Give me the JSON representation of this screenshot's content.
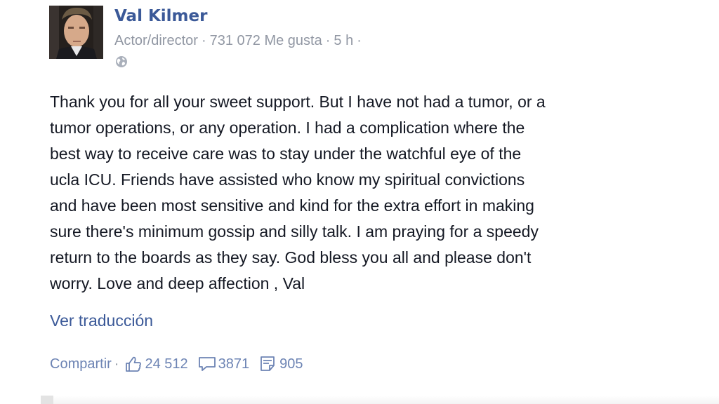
{
  "post": {
    "author": "Val Kilmer",
    "meta": {
      "category": "Actor/director",
      "likes_count": "731 072 Me gusta",
      "time": "5 h",
      "separator": "·"
    },
    "privacy_icon": "globe-icon",
    "body_lines": [
      "Thank you for all your sweet support. But I have not had a tumor, or a",
      "tumor operations, or any operation. I had a complication where the",
      "best way to receive care was to stay under the watchful eye of the",
      "ucla ICU. Friends have assisted who know my spiritual convictions",
      "and have been most sensitive and kind for the extra effort in making",
      "sure there's minimum gossip and silly talk. I am praying for a speedy",
      "return to the boards as they say. God bless you all and please don't",
      "worry. Love and deep affection , Val"
    ],
    "see_translation": "Ver traducción",
    "actions": {
      "share_label": "Compartir",
      "separator": "·",
      "likes": "24 512",
      "comments": "3871",
      "shares": "905"
    }
  },
  "colors": {
    "link": "#3b5998",
    "meta": "#9197a3",
    "text": "#141823",
    "action": "#6d84b4"
  }
}
